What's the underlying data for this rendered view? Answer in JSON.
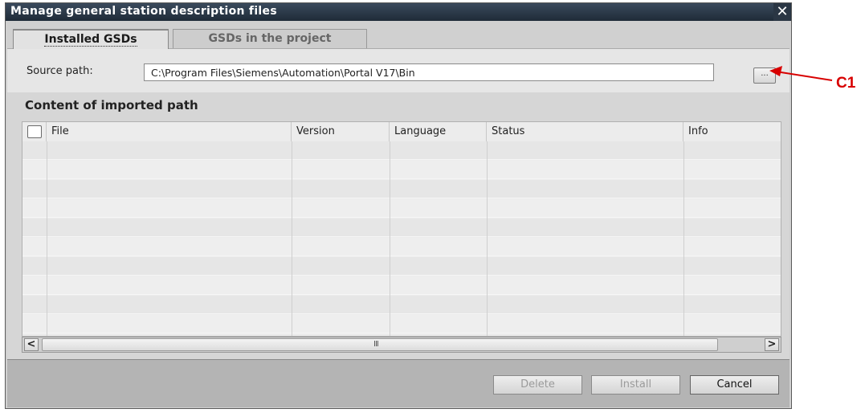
{
  "dialog": {
    "title": "Manage general station description files",
    "close_glyph": "✕"
  },
  "tabs": [
    {
      "label": "Installed GSDs",
      "active": true
    },
    {
      "label": "GSDs in the project",
      "active": false
    }
  ],
  "source": {
    "label": "Source path:",
    "value": "C:\\Program Files\\Siemens\\Automation\\Portal V17\\Bin",
    "browse_label": "..."
  },
  "content": {
    "heading": "Content of imported path",
    "columns": [
      "File",
      "Version",
      "Language",
      "Status",
      "Info"
    ],
    "rows": []
  },
  "scrollbar": {
    "left_arrow": "<",
    "right_arrow": ">",
    "grip": "III"
  },
  "buttons": {
    "delete": "Delete",
    "install": "Install",
    "cancel": "Cancel"
  },
  "annotation": {
    "label": "C1",
    "color": "#d80000"
  }
}
